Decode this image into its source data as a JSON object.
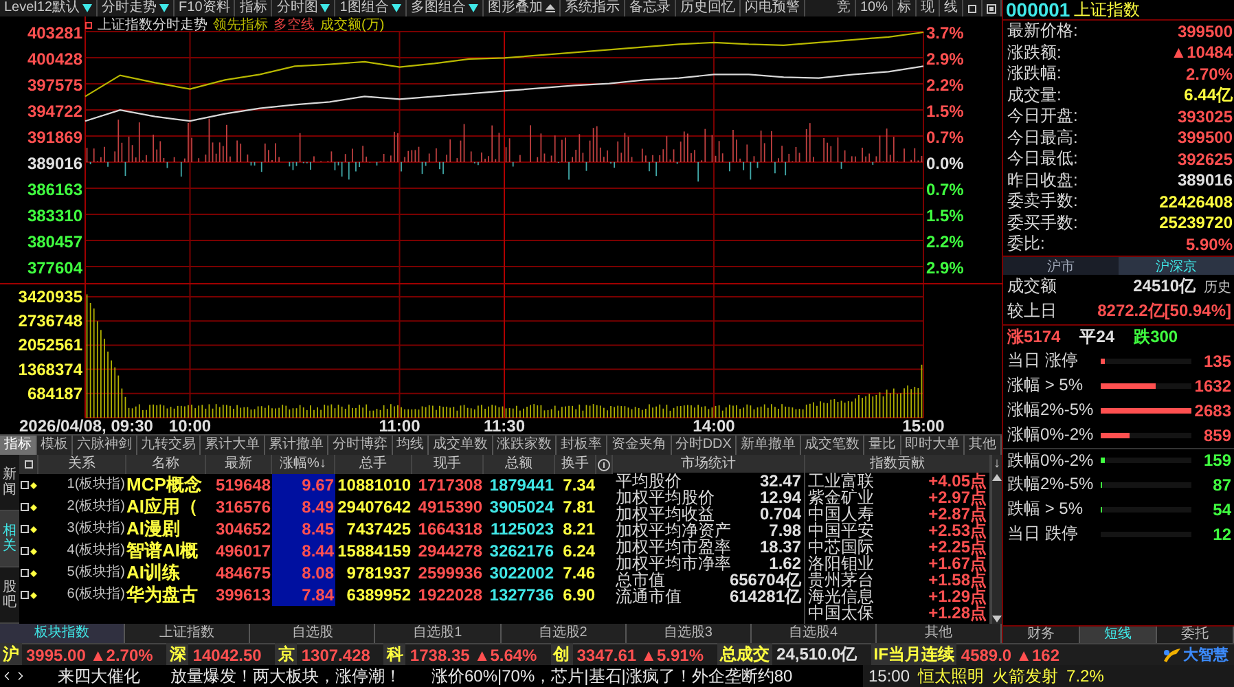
{
  "toolbar": {
    "items": [
      {
        "label": "Level12默认",
        "kind": "dropdown"
      },
      {
        "label": "分时走势",
        "kind": "dropdown"
      },
      {
        "label": "F10资料",
        "kind": "button"
      },
      {
        "label": "指标",
        "kind": "button"
      },
      {
        "label": "分时图",
        "kind": "dropdown"
      },
      {
        "label": "1图组合",
        "kind": "dropdown"
      },
      {
        "label": "多图组合",
        "kind": "dropdown"
      },
      {
        "label": "图形叠加",
        "kind": "eject"
      },
      {
        "label": "系统指示",
        "kind": "button"
      },
      {
        "label": "备忘录",
        "kind": "button"
      },
      {
        "label": "历史回忆",
        "kind": "button"
      },
      {
        "label": "闪电预警",
        "kind": "button"
      }
    ],
    "tools": [
      "竞",
      "10%",
      "标",
      "现",
      "线"
    ]
  },
  "chart": {
    "legend_extra": [
      {
        "label": "多空线",
        "color": "#e04040"
      },
      {
        "label": "成交额(万)",
        "color": "#c8c800"
      }
    ],
    "chart_data": {
      "type": "line",
      "categories": [
        null,
        null,
        null,
        null,
        null,
        null,
        null,
        null,
        null,
        null,
        null,
        null,
        null,
        null,
        null,
        null,
        null,
        null,
        null,
        null,
        null,
        null,
        null,
        null,
        null
      ],
      "series": [
        {
          "name": "上证指数分时走势",
          "color": "#d8d8d8",
          "values": [
            393500,
            394700,
            394000,
            393500,
            394300,
            394900,
            395300,
            395600,
            396200,
            395900,
            396200,
            396500,
            396800,
            397100,
            397400,
            397600,
            398000,
            398200,
            398600,
            398600,
            398300,
            398200,
            398600,
            398900,
            399500
          ]
        },
        {
          "name": "领先指标",
          "color": "#b8b800",
          "values": [
            396200,
            398500,
            397700,
            397000,
            398000,
            398600,
            399500,
            399700,
            400000,
            399400,
            399800,
            400300,
            400400,
            400700,
            401000,
            401300,
            401600,
            401900,
            402100,
            401900,
            401800,
            402100,
            402400,
            402700,
            403200
          ]
        }
      ],
      "ylim": [
        377604,
        403281
      ],
      "grid": true,
      "yticks": [
        {
          "value": 403281,
          "label": "403281"
        },
        {
          "value": 400428,
          "label": "400428"
        },
        {
          "value": 397575,
          "label": "397575"
        },
        {
          "value": 394722,
          "label": "394722"
        },
        {
          "value": 391869,
          "label": "391869"
        },
        {
          "value": 389016,
          "label": "389016"
        },
        {
          "value": 386163,
          "label": "386163"
        },
        {
          "value": 383310,
          "label": "383310"
        },
        {
          "value": 380457,
          "label": "380457"
        },
        {
          "value": 377604,
          "label": "377604"
        }
      ]
    },
    "time_axis": [
      "2026/04/08, 09:30",
      "10:00",
      "11:00",
      "11:30",
      "14:00",
      "15:00"
    ],
    "percent_axis": [
      {
        "label": "3.7%",
        "kind": "up"
      },
      {
        "label": "2.9%",
        "kind": "up"
      },
      {
        "label": "2.2%",
        "kind": "up"
      },
      {
        "label": "1.5%",
        "kind": "up"
      },
      {
        "label": "0.7%",
        "kind": "up"
      },
      {
        "label": "0.0%",
        "kind": "flat"
      },
      {
        "label": "0.7%",
        "kind": "down"
      },
      {
        "label": "1.5%",
        "kind": "down"
      },
      {
        "label": "2.2%",
        "kind": "down"
      },
      {
        "label": "2.9%",
        "kind": "down"
      }
    ],
    "volume_axis": [
      "3420935",
      "2736748",
      "2052561",
      "1368374",
      "684187"
    ]
  },
  "indicator_tabs": [
    {
      "label": "指标",
      "selected": true
    },
    {
      "label": "模板",
      "selected": false
    },
    {
      "label": "六脉神剑",
      "selected": false
    },
    {
      "label": "九转交易",
      "selected": false
    },
    {
      "label": "累计大单",
      "selected": false
    },
    {
      "label": "累计撤单",
      "selected": false
    },
    {
      "label": "分时博弈",
      "selected": false
    },
    {
      "label": "均线",
      "selected": false
    },
    {
      "label": "成交单数",
      "selected": false
    },
    {
      "label": "涨跌家数",
      "selected": false
    },
    {
      "label": "封板率",
      "selected": false
    },
    {
      "label": "资金夹角",
      "selected": false
    },
    {
      "label": "分时DDX",
      "selected": false
    },
    {
      "label": "新单撤单",
      "selected": false
    },
    {
      "label": "成交笔数",
      "selected": false
    },
    {
      "label": "量比",
      "selected": false
    },
    {
      "label": "即时大单",
      "selected": false
    },
    {
      "label": "其他",
      "selected": false
    }
  ],
  "side_tabs": [
    {
      "label": "新闻",
      "selected": false
    },
    {
      "label": "相关",
      "selected": true
    },
    {
      "label": "股吧",
      "selected": false
    }
  ],
  "table": {
    "select_all": {
      "checked": false
    },
    "columns": [
      {
        "label": "关系",
        "kind": "relation"
      },
      {
        "label": "名称",
        "kind": "name"
      },
      {
        "label": "最新",
        "kind": "up"
      },
      {
        "label": "涨幅%↓",
        "kind": "highlight"
      },
      {
        "label": "总手",
        "kind": "volume"
      },
      {
        "label": "现手",
        "kind": "up"
      },
      {
        "label": "总额",
        "kind": "amount"
      },
      {
        "label": "换手",
        "kind": "volume"
      }
    ],
    "rows": [
      {
        "checked": false,
        "cells": [
          "1(板块指)",
          "MCP概念",
          "519648",
          "9.67",
          "10881010",
          "1717308",
          "1879441",
          "7.34"
        ]
      },
      {
        "checked": false,
        "cells": [
          "2(板块指)",
          "AI应用（",
          "316576",
          "8.49",
          "29407642",
          "4915390",
          "3905024",
          "7.81"
        ]
      },
      {
        "checked": false,
        "cells": [
          "3(板块指)",
          "AI漫剧",
          "304652",
          "8.45",
          "7437425",
          "1664318",
          "1125023",
          "8.21"
        ]
      },
      {
        "checked": false,
        "cells": [
          "4(板块指)",
          "智谱AI概",
          "496017",
          "8.44",
          "15884159",
          "2944278",
          "3262176",
          "6.24"
        ]
      },
      {
        "checked": false,
        "cells": [
          "5(板块指)",
          "AI训练",
          "484675",
          "8.08",
          "9781937",
          "2599936",
          "3022002",
          "7.46"
        ]
      },
      {
        "checked": false,
        "cells": [
          "6(板块指)",
          "华为盘古",
          "399613",
          "7.84",
          "6389952",
          "1922028",
          "1327736",
          "6.90"
        ]
      }
    ]
  },
  "market_stats": {
    "title": "市场统计",
    "items": [
      {
        "label": "平均股价",
        "value": "32.47"
      },
      {
        "label": "加权平均股价",
        "value": "12.94"
      },
      {
        "label": "加权平均收益",
        "value": "0.704"
      },
      {
        "label": "加权平均净资产",
        "value": "7.98"
      },
      {
        "label": "加权平均市盈率",
        "value": "18.37"
      },
      {
        "label": "加权平均市净率",
        "value": "1.62"
      },
      {
        "label": "总市值",
        "value": "656704亿"
      },
      {
        "label": "流通市值",
        "value": "614281亿"
      }
    ]
  },
  "index_contribution": {
    "title": "指数贡献",
    "sort_mark": "↓",
    "items": [
      {
        "name": "工业富联",
        "value": "+4.05点"
      },
      {
        "name": "紫金矿业",
        "value": "+2.97点"
      },
      {
        "name": "中国人寿",
        "value": "+2.87点"
      },
      {
        "name": "中国平安",
        "value": "+2.53点"
      },
      {
        "name": "中芯国际",
        "value": "+2.25点"
      },
      {
        "name": "洛阳钼业",
        "value": "+1.67点"
      },
      {
        "name": "贵州茅台",
        "value": "+1.58点"
      },
      {
        "name": "海光信息",
        "value": "+1.29点"
      },
      {
        "name": "中国太保",
        "value": "+1.28点"
      }
    ]
  },
  "bottom_tabs": [
    {
      "label": "板块指数",
      "selected": true
    },
    {
      "label": "上证指数",
      "selected": false
    },
    {
      "label": "自选股",
      "selected": false
    },
    {
      "label": "自选股1",
      "selected": false
    },
    {
      "label": "自选股2",
      "selected": false
    },
    {
      "label": "自选股3",
      "selected": false
    },
    {
      "label": "自选股4",
      "selected": false
    },
    {
      "label": "其他",
      "selected": false
    }
  ],
  "quote": {
    "code": "000001",
    "name": "上证指数",
    "rows": [
      {
        "label": "最新价格:",
        "value": "399500",
        "kind": "up"
      },
      {
        "label": "涨跌额:",
        "value": "▲10484",
        "kind": "up"
      },
      {
        "label": "涨跌幅:",
        "value": "2.70%",
        "kind": "up"
      },
      {
        "label": "成交量:",
        "value": "6.44亿",
        "kind": "volume"
      },
      {
        "label": "今日开盘:",
        "value": "393025",
        "kind": "up"
      },
      {
        "label": "今日最高:",
        "value": "399500",
        "kind": "up"
      },
      {
        "label": "今日最低:",
        "value": "392625",
        "kind": "up"
      },
      {
        "label": "昨日收盘:",
        "value": "389016",
        "kind": "flat"
      },
      {
        "label": "委卖手数:",
        "value": "22426408",
        "kind": "volume"
      },
      {
        "label": "委买手数:",
        "value": "25239720",
        "kind": "volume"
      },
      {
        "label": "委比:",
        "value": "5.90%",
        "kind": "up"
      }
    ]
  },
  "market_tabs": [
    {
      "label": "沪市",
      "selected": false
    },
    {
      "label": "沪深京",
      "selected": true
    }
  ],
  "turnover": {
    "label": "成交额",
    "value": "24510亿",
    "link": "历史",
    "compare_label": "较上日",
    "compare_value": "8272.2亿[50.94%]"
  },
  "breadth": {
    "up": "涨5174",
    "flat": "平24",
    "down": "跌300"
  },
  "distribution": [
    {
      "label": "当日 涨停",
      "count": "135",
      "level": 0.05,
      "kind": "up"
    },
    {
      "label": "涨幅 > 5%",
      "count": "1632",
      "level": 0.61,
      "kind": "up"
    },
    {
      "label": "涨幅2%-5%",
      "count": "2683",
      "level": 1.0,
      "kind": "up"
    },
    {
      "label": "涨幅0%-2%",
      "count": "859",
      "level": 0.32,
      "kind": "up"
    },
    {
      "label": "跌幅0%-2%",
      "count": "159",
      "level": 0.04,
      "kind": "down"
    },
    {
      "label": "跌幅2%-5%",
      "count": "87",
      "level": 0.02,
      "kind": "down"
    },
    {
      "label": "跌幅 > 5%",
      "count": "54",
      "level": 0.02,
      "kind": "down"
    },
    {
      "label": "当日 跌停",
      "count": "12",
      "kind": "down"
    }
  ],
  "panel_tabs": [
    {
      "label": "财务",
      "selected": false
    },
    {
      "label": "短线",
      "selected": true
    },
    {
      "label": "委托",
      "selected": false
    }
  ],
  "ticker": {
    "items": [
      {
        "label": "沪",
        "price": "3995.00",
        "change": "▲2.70%",
        "kind": "up"
      },
      {
        "label": "深",
        "price": "14042.50",
        "kind": "up"
      },
      {
        "label": "京",
        "price": "1307.428",
        "kind": "up"
      },
      {
        "label": "科",
        "price": "1738.35",
        "change": "▲5.64%",
        "kind": "up"
      },
      {
        "label": "创",
        "price": "3347.61",
        "change": "▲5.91%",
        "kind": "up"
      },
      {
        "label": "总成交",
        "price": "24,510.0亿",
        "kind": "flat"
      },
      {
        "label": "IF当月连续",
        "price": "4589.0",
        "change": "▲162",
        "kind": "up"
      }
    ],
    "logo": "大智慧"
  },
  "news": {
    "headlines": [
      "来四大催化",
      "放量爆发！两大板块，涨停潮！",
      "涨价60%|70%，芯片|基石|涨疯了！外企垄断约80"
    ],
    "alert": {
      "time": "15:00",
      "name": "恒太照明",
      "event": "火箭发射",
      "change": "7.2%"
    }
  }
}
